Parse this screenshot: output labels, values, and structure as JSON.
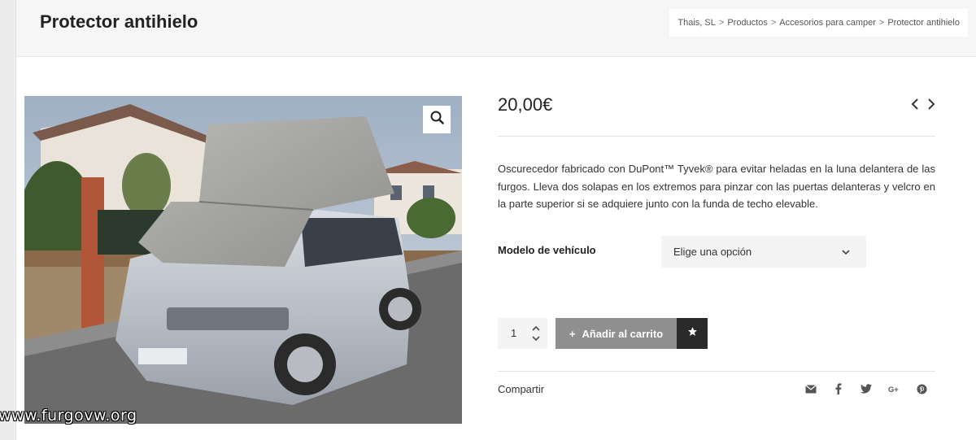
{
  "header": {
    "title": "Protector antihielo",
    "breadcrumb": [
      "Thais, SL",
      "Productos",
      "Accesorios para camper",
      "Protector antihielo"
    ],
    "breadcrumb_separator": ">"
  },
  "product": {
    "price": "20,00€",
    "description": "Oscurecedor fabricado con DuPont™ Tyvek® para evitar heladas en la luna delantera de las furgos. Lleva dos solapas en los extremos para pinzar con las puertas delanteras y velcro en la parte superior si se adquiere junto con la funda de techo elevable.",
    "image_watermark": "www.furgovw.org",
    "variant": {
      "label": "Modelo de vehículo",
      "selected": "Elige una opción"
    },
    "quantity": "1",
    "add_to_cart": {
      "icon": "+",
      "label": "Añadir al carrito"
    },
    "share_label": "Compartir"
  },
  "icons": {
    "zoom": "search-icon",
    "prev": "chevron-left-icon",
    "next": "chevron-right-icon",
    "dropdown": "chevron-down-icon",
    "qty_up": "chevron-up-icon",
    "qty_down": "chevron-down-icon",
    "wishlist": "star-icon",
    "share": [
      "envelope-icon",
      "facebook-icon",
      "twitter-icon",
      "google-plus-icon",
      "pinterest-icon"
    ]
  },
  "colors": {
    "add_to_cart_bg": "#8f8f8f",
    "wishlist_bg": "#2a2a2a",
    "title_bar_bg": "#f6f6f6"
  }
}
